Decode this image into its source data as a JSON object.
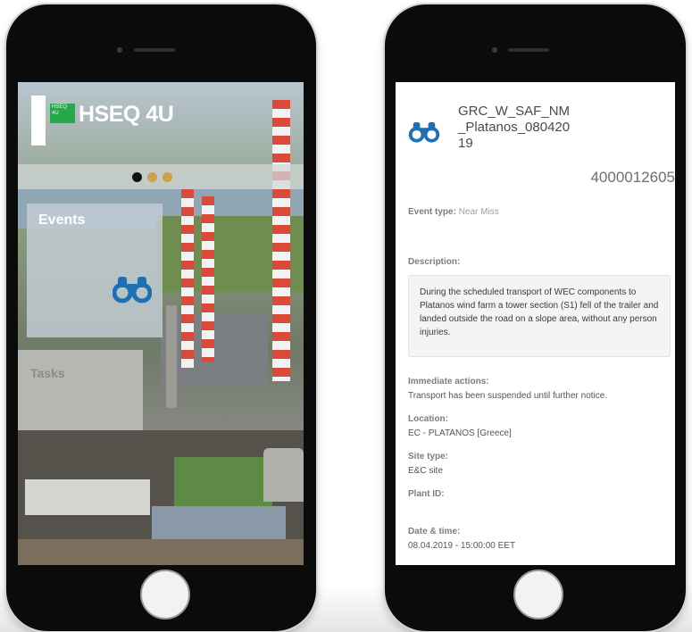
{
  "left_screen": {
    "logo": {
      "text": "HSEQ 4U",
      "badge_text": "HSEQ 4U"
    },
    "carousel_dots": {
      "count": 3,
      "active_index": 0,
      "active_color": "#111111",
      "inactive_color": "#c9a24a"
    },
    "tiles": [
      {
        "label": "Events",
        "icon": "binoculars-icon"
      },
      {
        "label": "Tasks"
      }
    ]
  },
  "right_screen": {
    "event": {
      "title": "GRC_W_SAF_NM_Platanos_08042019",
      "title_lines": [
        "GRC_W_SAF_NM",
        "_Platanos_080420",
        "19"
      ],
      "number": "4000012605",
      "icon": "binoculars-icon"
    },
    "event_type": {
      "label": "Event type:",
      "value": "Near Miss"
    },
    "description": {
      "label": "Description:",
      "text": "During the scheduled transport of WEC components to Platanos wind farm a tower section (S1) fell of the trailer and landed outside the road on a slope area, without any person injuries."
    },
    "immediate_actions": {
      "label": "Immediate actions:",
      "value": "Transport has been suspended until further notice."
    },
    "location": {
      "label": "Location:",
      "value": "EC - PLATANOS [Greece]"
    },
    "site_type": {
      "label": "Site type:",
      "value": "E&C site"
    },
    "plant_id": {
      "label": "Plant ID:",
      "value": ""
    },
    "date_time": {
      "label": "Date & time:",
      "value": "08.04.2019 - 15:00:00 EET"
    }
  },
  "colors": {
    "icon_blue": "#1f6fb5",
    "brand_green": "#27a84b",
    "device_body": "#0b0b0b"
  }
}
